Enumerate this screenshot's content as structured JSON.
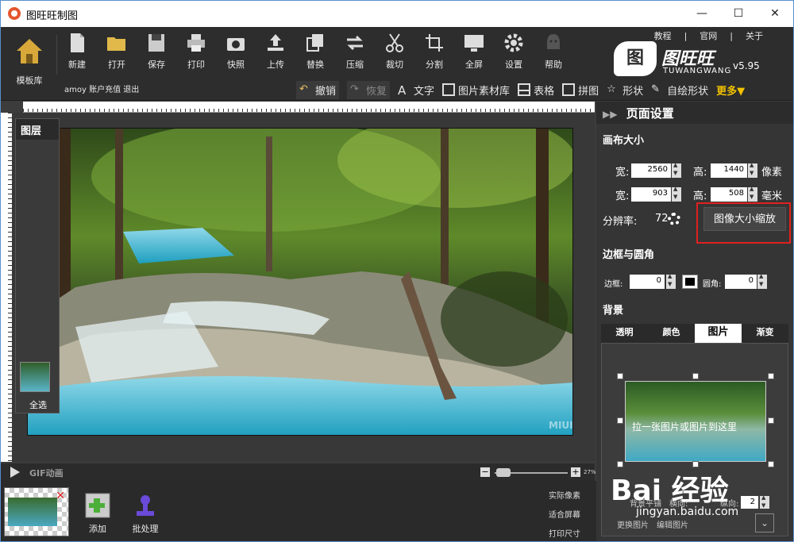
{
  "window": {
    "title": "图旺旺制图",
    "controls": [
      "—",
      "☐",
      "✕"
    ]
  },
  "toolbar": {
    "home_label": "模板库",
    "buttons": [
      {
        "label": "新建",
        "icon": "new-file-icon"
      },
      {
        "label": "打开",
        "icon": "folder-open-icon"
      },
      {
        "label": "保存",
        "icon": "save-icon"
      },
      {
        "label": "打印",
        "icon": "printer-icon"
      },
      {
        "label": "快照",
        "icon": "camera-icon"
      },
      {
        "label": "上传",
        "icon": "upload-icon"
      },
      {
        "label": "替换",
        "icon": "replace-icon"
      },
      {
        "label": "压缩",
        "icon": "compress-icon"
      },
      {
        "label": "裁切",
        "icon": "scissors-icon"
      },
      {
        "label": "分割",
        "icon": "crop-icon"
      },
      {
        "label": "全屏",
        "icon": "monitor-icon"
      },
      {
        "label": "设置",
        "icon": "gear-icon"
      },
      {
        "label": "帮助",
        "icon": "help-icon"
      }
    ],
    "top_links": [
      "教程",
      "|",
      "官网",
      "|",
      "关于"
    ],
    "logo": {
      "mark": "图",
      "name": "图旺旺",
      "sub": "TUWANGWANG",
      "version": "v5.95"
    },
    "account": {
      "user": "amoy",
      "recharge": "账户充值",
      "logout": "退出"
    },
    "undo": "撤销",
    "redo": "恢复",
    "tools": [
      {
        "label": "文字",
        "icon": "text-icon"
      },
      {
        "label": "图片素材库",
        "icon": "image-library-icon"
      },
      {
        "label": "表格",
        "icon": "table-icon"
      },
      {
        "label": "拼图",
        "icon": "collage-icon"
      },
      {
        "label": "形状",
        "icon": "shape-icon"
      },
      {
        "label": "自绘形状",
        "icon": "pen-icon"
      }
    ],
    "more": "更多▼"
  },
  "layers": {
    "title": "图层",
    "select_all": "全选"
  },
  "canvas": {
    "watermark": "MIUI"
  },
  "gif_bar": {
    "label": "GIF动画",
    "zoom_minus": "−",
    "zoom_plus": "+",
    "zoom_level": "27%"
  },
  "bottom": {
    "add_label": "添加",
    "batch_label": "批处理",
    "actual_pixels": "实际像素",
    "fit_screen": "适合屏幕",
    "print_size": "打印尺寸"
  },
  "panel": {
    "title": "页面设置",
    "canvas_size": "画布大小",
    "width_label": "宽:",
    "height_label": "高:",
    "width_px": "2560",
    "height_px": "1440",
    "unit_px": "像素",
    "width_mm": "903",
    "height_mm": "508",
    "unit_mm": "毫米",
    "dpi_label": "分辨率:",
    "dpi_value": "72",
    "resize_button": "图像大小缩放",
    "border_section": "边框与圆角",
    "border_label": "边框:",
    "border_value": "0",
    "radius_label": "圆角:",
    "radius_value": "0",
    "background_section": "背景",
    "bg_tabs": [
      {
        "label": "透明",
        "active": false
      },
      {
        "label": "颜色",
        "active": false
      },
      {
        "label": "图片",
        "active": true
      },
      {
        "label": "渐变",
        "active": false
      }
    ],
    "preview_hint": "拉一张图片或图片到这里",
    "bg_bottom_left": "背景平铺",
    "bg_horizontal_label": "横向:",
    "bg_vertical_label": "纵向:",
    "bg_vertical_value": "2",
    "replace_image": "更换图片",
    "edit_image": "编辑图片",
    "baidu_watermark": "Bai  经验",
    "baidu_url": "jingyan.baidu.com"
  },
  "colors": {
    "toolbar_bg": "#2d2d2d",
    "panel_bg": "#353535",
    "highlight_red": "#e02020",
    "more_yellow": "#f2c200"
  }
}
